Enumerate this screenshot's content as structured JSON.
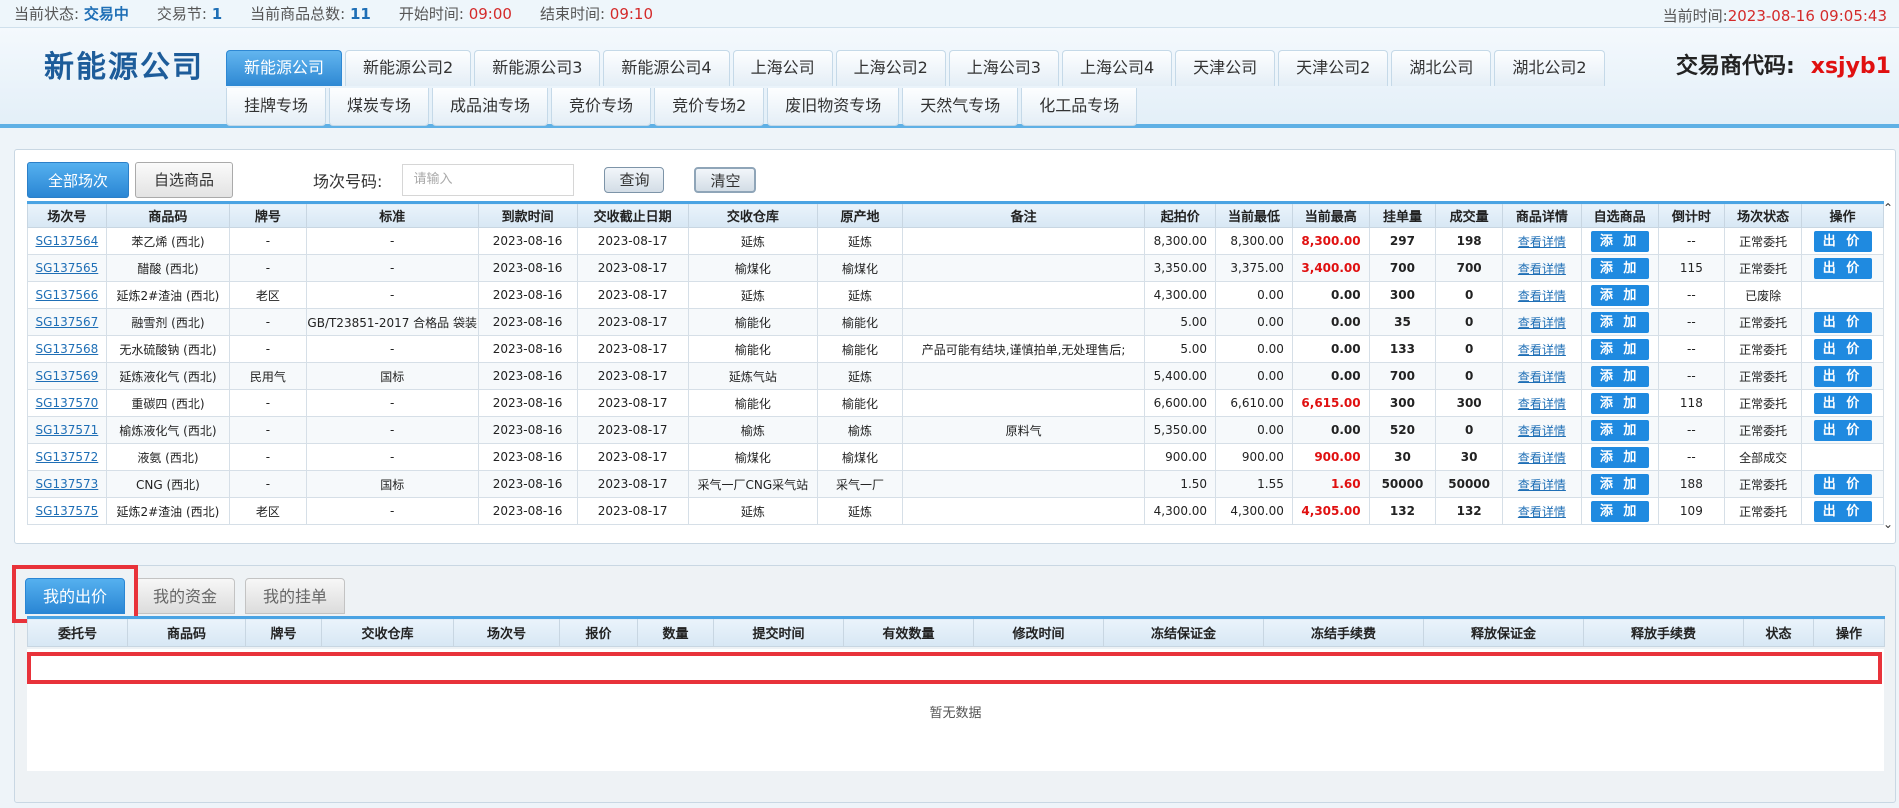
{
  "status": {
    "state_label": "当前状态:",
    "state_value": "交易中",
    "session_label": "交易节:",
    "session_value": "1",
    "count_label": "当前商品总数:",
    "count_value": "11",
    "start_label": "开始时间:",
    "start_value": "09:00",
    "end_label": "结束时间:",
    "end_value": "09:10",
    "now_label": "当前时间:",
    "now_value": "2023-08-16 09:05:43"
  },
  "header": {
    "logo": "新能源公司",
    "trader_label": "交易商代码:",
    "trader_code": "xsjyb1",
    "company_tabs": [
      "新能源公司",
      "新能源公司2",
      "新能源公司3",
      "新能源公司4",
      "上海公司",
      "上海公司2",
      "上海公司3",
      "上海公司4",
      "天津公司",
      "天津公司2",
      "湖北公司",
      "湖北公司2"
    ],
    "market_tabs": [
      "挂牌专场",
      "煤炭专场",
      "成品油专场",
      "竞价专场",
      "竞价专场2",
      "废旧物资专场",
      "天然气专场",
      "化工品专场"
    ]
  },
  "toolbar": {
    "all_sessions": "全部场次",
    "my_goods": "自选商品",
    "session_no_label": "场次号码:",
    "search_placeholder": "请输入",
    "query": "查询",
    "clear": "清空"
  },
  "table": {
    "columns": [
      "场次号",
      "商品码",
      "牌号",
      "标准",
      "到款时间",
      "交收截止日期",
      "交收仓库",
      "原产地",
      "备注",
      "起拍价",
      "当前最低",
      "当前最高",
      "挂单量",
      "成交量",
      "商品详情",
      "自选商品",
      "倒计时",
      "场次状态",
      "操作"
    ],
    "detail_text": "查看详情",
    "add_text": "添 加",
    "bid_text": "出 价",
    "rows": [
      [
        "SG137564",
        "苯乙烯 (西北)",
        "-",
        "-",
        "2023-08-16",
        "2023-08-17",
        "延炼",
        "延炼",
        "",
        "8,300.00",
        "8,300.00",
        "8,300.00",
        "297",
        "198",
        "--",
        "正常委托",
        true,
        true
      ],
      [
        "SG137565",
        "醋酸 (西北)",
        "-",
        "-",
        "2023-08-16",
        "2023-08-17",
        "榆煤化",
        "榆煤化",
        "",
        "3,350.00",
        "3,375.00",
        "3,400.00",
        "700",
        "700",
        "115",
        "正常委托",
        true,
        true
      ],
      [
        "SG137566",
        "延炼2#渣油 (西北)",
        "老区",
        "-",
        "2023-08-16",
        "2023-08-17",
        "延炼",
        "延炼",
        "",
        "4,300.00",
        "0.00",
        "0.00",
        "300",
        "0",
        "--",
        "已废除",
        false,
        false
      ],
      [
        "SG137567",
        "融雪剂 (西北)",
        "-",
        "GB/T23851-2017 合格品 袋装",
        "2023-08-16",
        "2023-08-17",
        "榆能化",
        "榆能化",
        "",
        "5.00",
        "0.00",
        "0.00",
        "35",
        "0",
        "--",
        "正常委托",
        false,
        true
      ],
      [
        "SG137568",
        "无水硫酸钠 (西北)",
        "-",
        "-",
        "2023-08-16",
        "2023-08-17",
        "榆能化",
        "榆能化",
        "产品可能有结块,谨慎拍单,无处理售后;",
        "5.00",
        "0.00",
        "0.00",
        "133",
        "0",
        "--",
        "正常委托",
        false,
        true
      ],
      [
        "SG137569",
        "延炼液化气 (西北)",
        "民用气",
        "国标",
        "2023-08-16",
        "2023-08-17",
        "延炼气站",
        "延炼",
        "",
        "5,400.00",
        "0.00",
        "0.00",
        "700",
        "0",
        "--",
        "正常委托",
        false,
        true
      ],
      [
        "SG137570",
        "重碳四 (西北)",
        "-",
        "-",
        "2023-08-16",
        "2023-08-17",
        "榆能化",
        "榆能化",
        "",
        "6,600.00",
        "6,610.00",
        "6,615.00",
        "300",
        "300",
        "118",
        "正常委托",
        true,
        true
      ],
      [
        "SG137571",
        "榆炼液化气 (西北)",
        "-",
        "-",
        "2023-08-16",
        "2023-08-17",
        "榆炼",
        "榆炼",
        "原料气",
        "5,350.00",
        "0.00",
        "0.00",
        "520",
        "0",
        "--",
        "正常委托",
        false,
        true
      ],
      [
        "SG137572",
        "液氨 (西北)",
        "-",
        "-",
        "2023-08-16",
        "2023-08-17",
        "榆煤化",
        "榆煤化",
        "",
        "900.00",
        "900.00",
        "900.00",
        "30",
        "30",
        "--",
        "全部成交",
        true,
        false
      ],
      [
        "SG137573",
        "CNG (西北)",
        "-",
        "国标",
        "2023-08-16",
        "2023-08-17",
        "采气一厂CNG采气站",
        "采气一厂",
        "",
        "1.50",
        "1.55",
        "1.60",
        "50000",
        "50000",
        "188",
        "正常委托",
        true,
        true
      ],
      [
        "SG137575",
        "延炼2#渣油 (西北)",
        "老区",
        "-",
        "2023-08-16",
        "2023-08-17",
        "延炼",
        "延炼",
        "",
        "4,300.00",
        "4,300.00",
        "4,305.00",
        "132",
        "132",
        "109",
        "正常委托",
        true,
        true
      ]
    ]
  },
  "bottom": {
    "tabs": [
      "我的出价",
      "我的资金",
      "我的挂单"
    ],
    "columns": [
      "委托号",
      "商品码",
      "牌号",
      "交收仓库",
      "场次号",
      "报价",
      "数量",
      "提交时间",
      "有效数量",
      "修改时间",
      "冻结保证金",
      "冻结手续费",
      "释放保证金",
      "释放手续费",
      "状态",
      "操作"
    ],
    "empty_text": "暂无数据"
  },
  "colors": {
    "accent": "#2a86d4",
    "highlight_red": "#e01010",
    "annotation_box": "#e8323a"
  }
}
